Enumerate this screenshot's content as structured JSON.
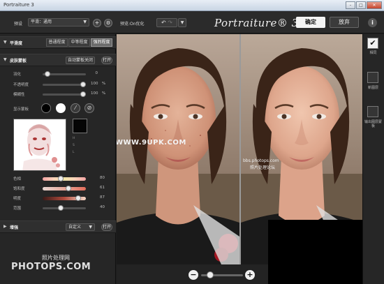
{
  "window": {
    "title": "Portraiture 3",
    "controls": [
      "-",
      "□",
      "✕"
    ]
  },
  "toolbar": {
    "preset_label": "预设",
    "preset_value": "平滑：通用",
    "preview_label": "预览:On优化",
    "undo_icon": "undo-icon",
    "redo_icon": "redo-icon",
    "logo": "Portraiture® 3",
    "ok_label": "确定",
    "cancel_label": "放弃",
    "info_label": "i"
  },
  "smoothing": {
    "title": "平滑度",
    "levels": [
      "普通程度",
      "中等程度",
      "强烈程度"
    ],
    "active_index": 2
  },
  "skin_mask": {
    "title": "皮肤蒙板",
    "auto_mask_label": "自动蒙板关闭",
    "open_label": "打开",
    "sliders": [
      {
        "label": "羽化",
        "value": "0",
        "unit": "",
        "level": 0.05
      },
      {
        "label": "不透明度",
        "value": "100",
        "unit": "%",
        "level": 1.0
      },
      {
        "label": "模糊性",
        "value": "100",
        "unit": "%",
        "level": 1.0
      }
    ],
    "show_mask_label": "显示蒙板",
    "color_rows": [
      {
        "label": "色相",
        "value": "80",
        "level": 0.4
      },
      {
        "label": "饱和度",
        "value": "61",
        "level": 0.62
      },
      {
        "label": "明度",
        "value": "87",
        "level": 0.87
      },
      {
        "label": "范围",
        "value": "40",
        "level": 0.4
      }
    ]
  },
  "enhance": {
    "title": "增强",
    "preset_value": "自定义",
    "open_label": "打开"
  },
  "watermarks": {
    "photo_site": "WWW.9UPK.COM",
    "site_small": "bbs.photops.com",
    "site_small_cn": "照片处理论坛",
    "bottom_cn": "照片处理网",
    "bottom_en": "PHOTOPS.COM"
  },
  "zoom": {
    "minus": "−",
    "plus": "+",
    "level": 0.15
  },
  "right_panel": {
    "items": [
      {
        "label": "相同",
        "checked": true
      },
      {
        "label": "新图层",
        "checked": false
      },
      {
        "label": "输出图层蒙板",
        "checked": false
      }
    ]
  }
}
